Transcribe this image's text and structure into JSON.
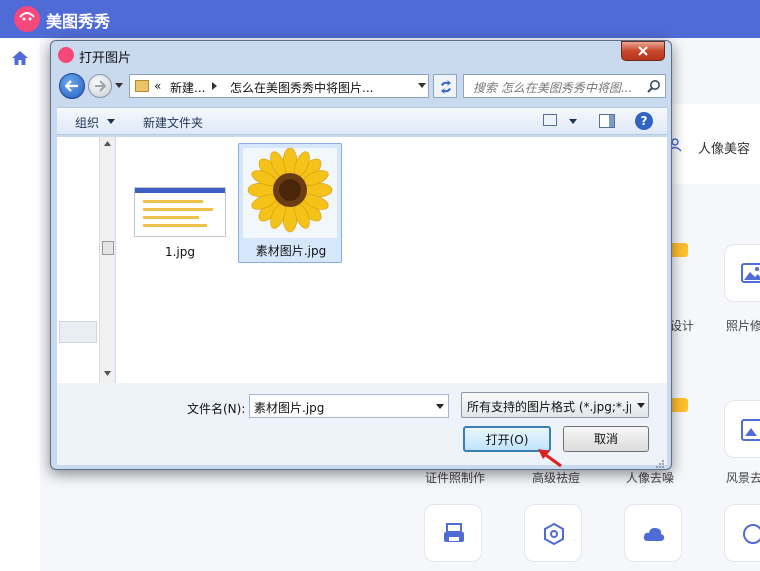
{
  "app": {
    "title": "美图秀秀",
    "tab_label": "人像美容",
    "tools": [
      {
        "label": "设计"
      },
      {
        "label": "照片修"
      },
      {
        "label": "证件照制作"
      },
      {
        "label": "高级祛痘"
      },
      {
        "label": "人像去噪"
      },
      {
        "label": "风景去"
      }
    ]
  },
  "dialog": {
    "title": "打开图片",
    "nav": {
      "breadcrumb_prefix": "«",
      "breadcrumb_parent": "新建...",
      "breadcrumb_current": "怎么在美图秀秀中将图片...",
      "search_placeholder": "搜索 怎么在美图秀秀中将图..."
    },
    "toolbar": {
      "organize": "组织",
      "new_folder": "新建文件夹"
    },
    "files": [
      {
        "name": "1.jpg",
        "selected": false
      },
      {
        "name": "素材图片.jpg",
        "selected": true
      }
    ],
    "footer": {
      "filename_label": "文件名(N):",
      "filename_value": "素材图片.jpg",
      "filetype_value": "所有支持的图片格式 (*.jpg;*.jp",
      "open_label": "打开(O)",
      "cancel_label": "取消"
    }
  },
  "colors": {
    "app_header": "#4f6bd6",
    "logo": "#f6487a",
    "dialog_frame": "#c9d9ee",
    "selection": "#d7e7fb",
    "open_border": "#3c7fb1",
    "arrow": "#e0201c"
  }
}
